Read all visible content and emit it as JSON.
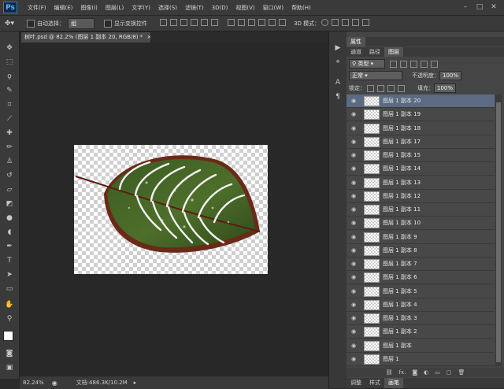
{
  "app": {
    "logo": "Ps"
  },
  "menu": [
    "文件(F)",
    "编辑(E)",
    "图像(I)",
    "图层(L)",
    "文字(Y)",
    "选择(S)",
    "滤镜(T)",
    "3D(D)",
    "视图(V)",
    "窗口(W)",
    "帮助(H)"
  ],
  "window_controls": [
    "–",
    "□",
    "✕"
  ],
  "options_bar": {
    "auto_select_label": "自动选择：",
    "auto_select_value": "组",
    "show_transform_label": "显示变换控件",
    "mode_3d_label": "3D 模式："
  },
  "document": {
    "tab_title": "树叶.psd @ 82.2% (图层 1 副本 20, RGB/8) *",
    "tab_close": "×"
  },
  "status_bar": {
    "zoom": "82.24%",
    "doc_info": "文档:486.3K/10.2M"
  },
  "layers_panel": {
    "top_tabs": [
      "属性"
    ],
    "tabs": [
      "通道",
      "路径",
      "图层"
    ],
    "active_tab": "图层",
    "filter_type": "类型",
    "blend_mode": "正常",
    "opacity_label": "不透明度：",
    "opacity_value": "100%",
    "lock_label": "锁定：",
    "fill_label": "填充：",
    "fill_value": "100%",
    "layers": [
      "图层 1 副本 20",
      "图层 1 副本 19",
      "图层 1 副本 18",
      "图层 1 副本 17",
      "图层 1 副本 15",
      "图层 1 副本 14",
      "图层 1 副本 13",
      "图层 1 副本 12",
      "图层 1 副本 11",
      "图层 1 副本 10",
      "图层 1 副本 9",
      "图层 1 副本 8",
      "图层 1 副本 7",
      "图层 1 副本 6",
      "图层 1 副本 5",
      "图层 1 副本 4",
      "图层 1 副本 3",
      "图层 1 副本 2",
      "图层 1 副本",
      "图层 1"
    ],
    "selected_index": 0,
    "bottom_tabs": [
      "调整",
      "样式",
      "画笔"
    ],
    "footer_icons": [
      "link-icon",
      "fx-icon",
      "mask-icon",
      "adjustment-icon",
      "group-icon",
      "new-layer-icon",
      "trash-icon"
    ],
    "footer_fx": "fx."
  }
}
